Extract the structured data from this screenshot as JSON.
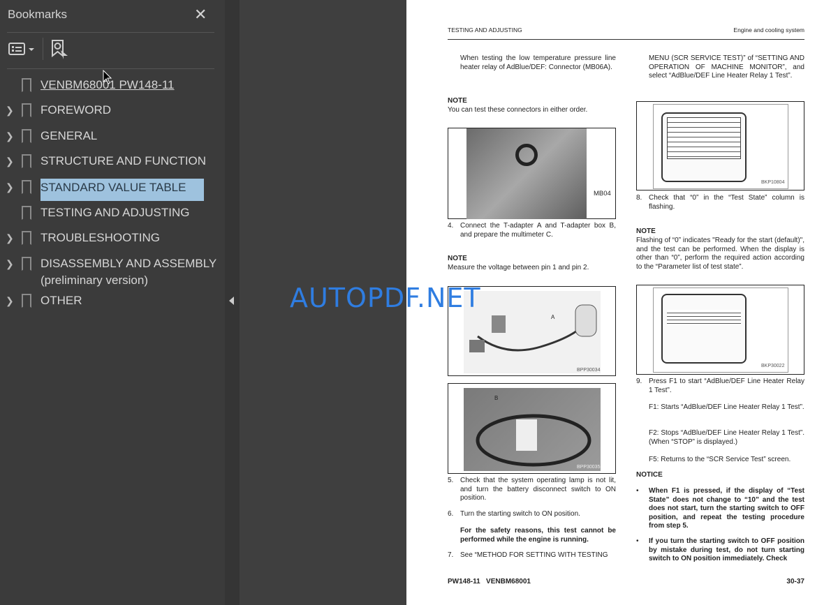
{
  "sidebar": {
    "title": "Bookmarks",
    "close": "✕",
    "options_icon": "list-options-icon",
    "find_icon": "find-bookmark-icon",
    "items": [
      {
        "label": "VENBM68001 PW148-11",
        "expandable": false
      },
      {
        "label": "FOREWORD",
        "expandable": true
      },
      {
        "label": "GENERAL",
        "expandable": true
      },
      {
        "label": "STRUCTURE AND FUNCTION",
        "expandable": true
      },
      {
        "label": "STANDARD VALUE TABLE",
        "expandable": true,
        "selected": true
      },
      {
        "label": "TESTING AND ADJUSTING",
        "expandable": false
      },
      {
        "label": "TROUBLESHOOTING",
        "expandable": true
      },
      {
        "label": "DISASSEMBLY AND ASSEMBLY",
        "label2": "(preliminary version)",
        "expandable": true
      },
      {
        "label": "OTHER",
        "expandable": true
      }
    ]
  },
  "watermark": "AUTOPDF.NET",
  "page": {
    "header_left": "TESTING AND ADJUSTING",
    "header_right": "Engine and cooling system",
    "footer_left": "PW148-11   VENBM68001",
    "footer_right": "30-37",
    "left": {
      "p1": "When testing the low temperature pressure line heater relay of AdBlue/DEF: Connector (MB06A).",
      "note1_title": "NOTE",
      "note1": "You can test these connectors in either order.",
      "fig1_label": "MB04",
      "step4": "4.",
      "step4_text": "Connect the T-adapter A and T-adapter box B, and prepare the multimeter C.",
      "note2_title": "NOTE",
      "note2": "Measure the voltage between pin 1 and pin 2.",
      "fig2_label": "A",
      "fig2_code": "BPP30034",
      "fig3_label": "B",
      "fig3_code": "BPP30035",
      "step5": "5.",
      "step5_text": "Check that the system operating lamp is not lit, and turn the battery disconnect switch to ON position.",
      "step6": "6.",
      "step6_text": "Turn the starting switch to ON position.",
      "step6_bold": "For the safety reasons, this test cannot be performed while the engine is running.",
      "step7": "7.",
      "step7_text": "See “METHOD FOR SETTING WITH TESTING"
    },
    "right": {
      "p1": "MENU (SCR SERVICE TEST)” of “SETTING AND OPERATION OF MACHINE MONITOR”, and select “AdBlue/DEF Line Heater Relay 1 Test”.",
      "fig4_code": "BKP10804",
      "step8": "8.",
      "step8_text": "Check that “0” in the “Test State” column is flashing.",
      "note_title": "NOTE",
      "note": "Flashing of “0” indicates \"Ready for the start (default)\", and the test can be performed. When the display is other than “0”, perform the required action according to the “Parameter list of test state”.",
      "fig5_code": "BKP30022",
      "step9": "9.",
      "step9_text": "Press F1 to start “AdBlue/DEF Line Heater Relay 1 Test”.",
      "f1": "F1: Starts “AdBlue/DEF Line Heater Relay 1 Test”.",
      "f2": "F2: Stops “AdBlue/DEF Line Heater Relay 1 Test”. (When “STOP” is displayed.)",
      "f5": "F5: Returns to the “SCR Service Test” screen.",
      "notice_title": "NOTICE",
      "bullet1": "When F1 is pressed, if the display of “Test State” does not change to “10” and the test does not start, turn the starting switch to OFF position, and repeat the testing procedure from step 5.",
      "bullet2": "If you turn the starting switch to OFF position by mistake during test, do not turn starting switch to ON position immediately. Check"
    }
  }
}
